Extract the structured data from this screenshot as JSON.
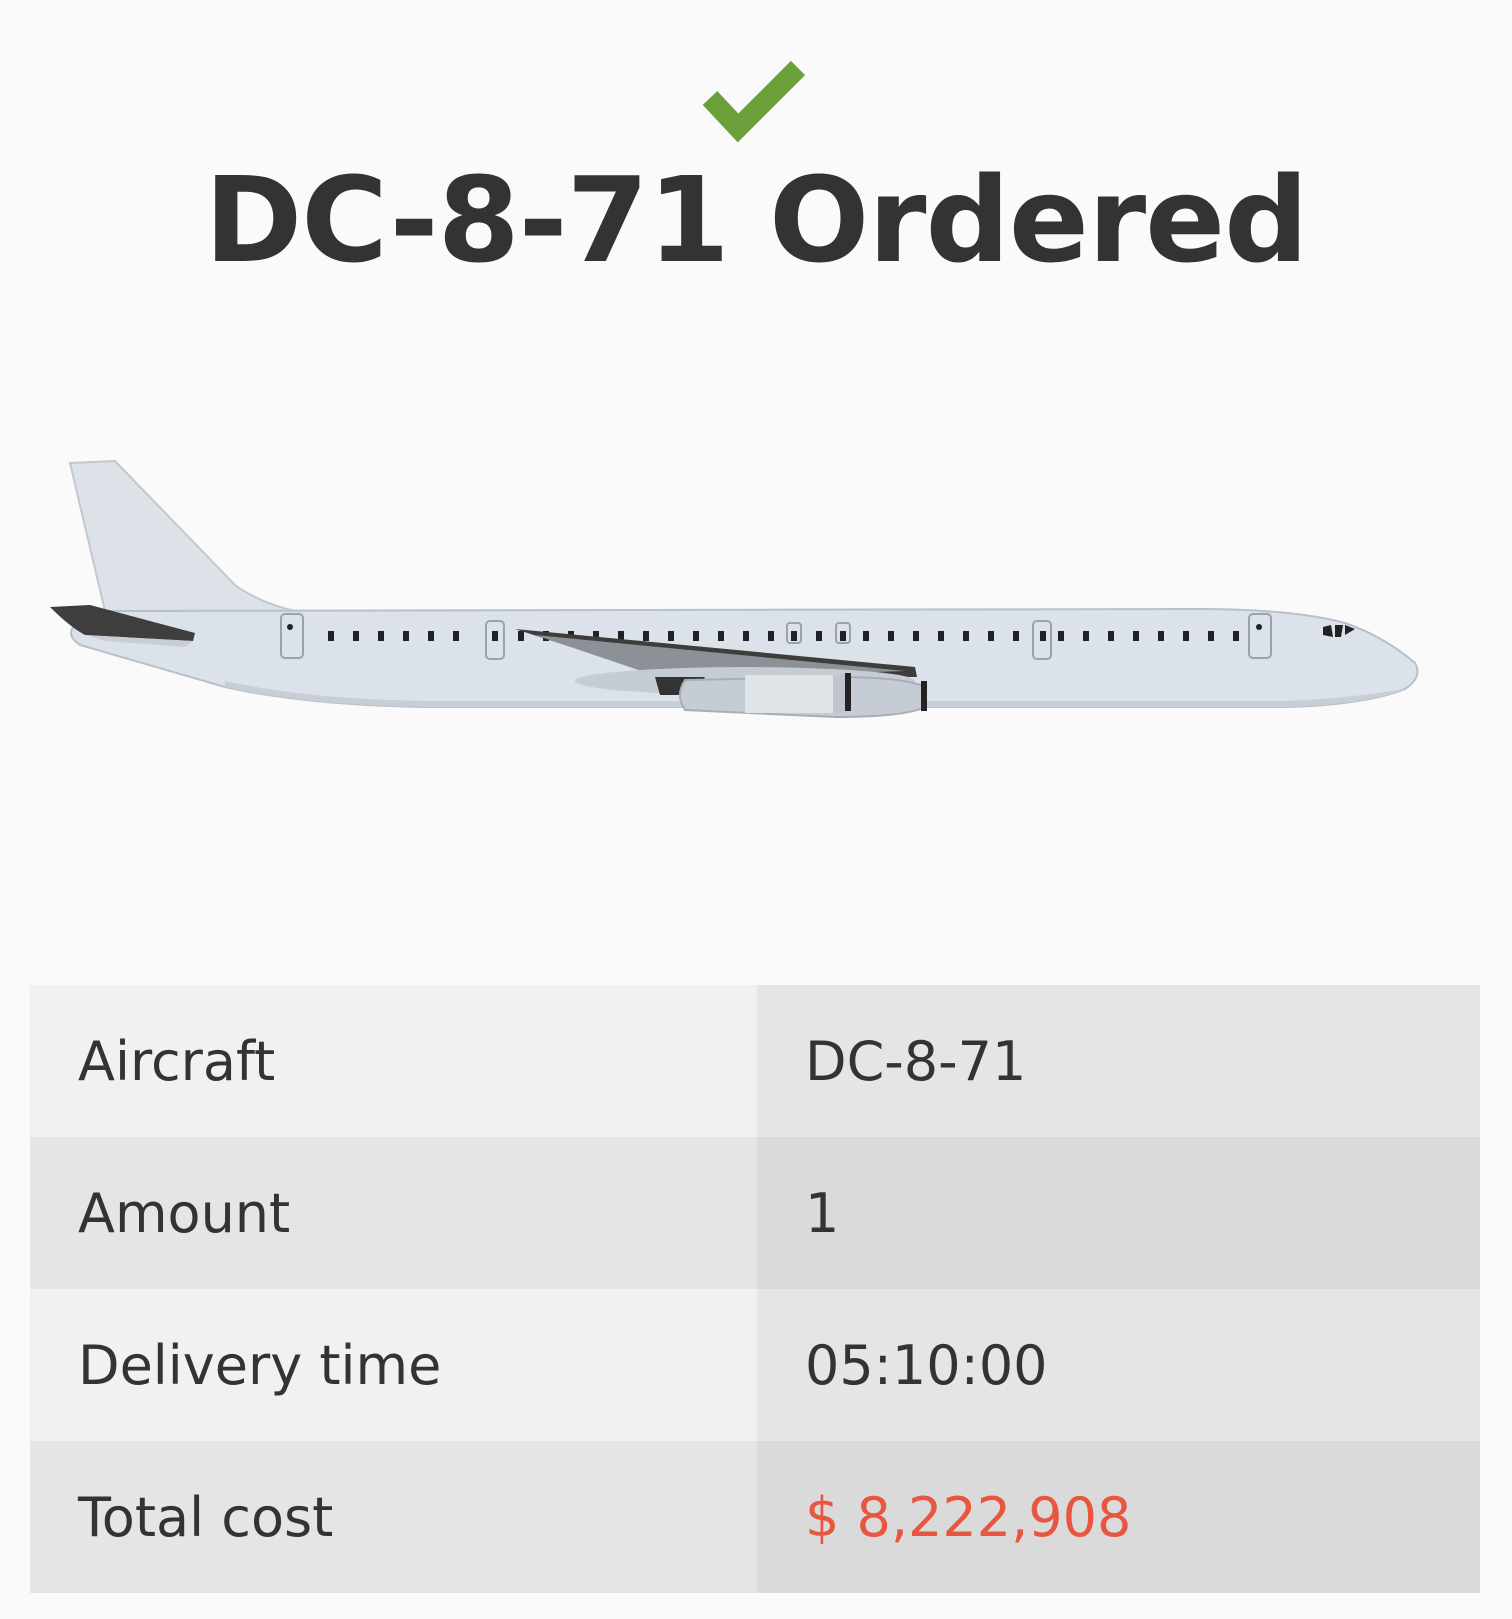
{
  "header": {
    "status_icon": "checkmark-icon",
    "title": "DC-8-71 Ordered"
  },
  "aircraft_image": {
    "icon": "airplane-icon"
  },
  "details": [
    {
      "label": "Aircraft",
      "value": "DC-8-71"
    },
    {
      "label": "Amount",
      "value": "1"
    },
    {
      "label": "Delivery time",
      "value": "05:10:00"
    },
    {
      "label": "Total cost",
      "value": "$ 8,222,908"
    }
  ],
  "colors": {
    "check": "#6a9f3a",
    "cost": "#e8563f",
    "text": "#333333"
  }
}
